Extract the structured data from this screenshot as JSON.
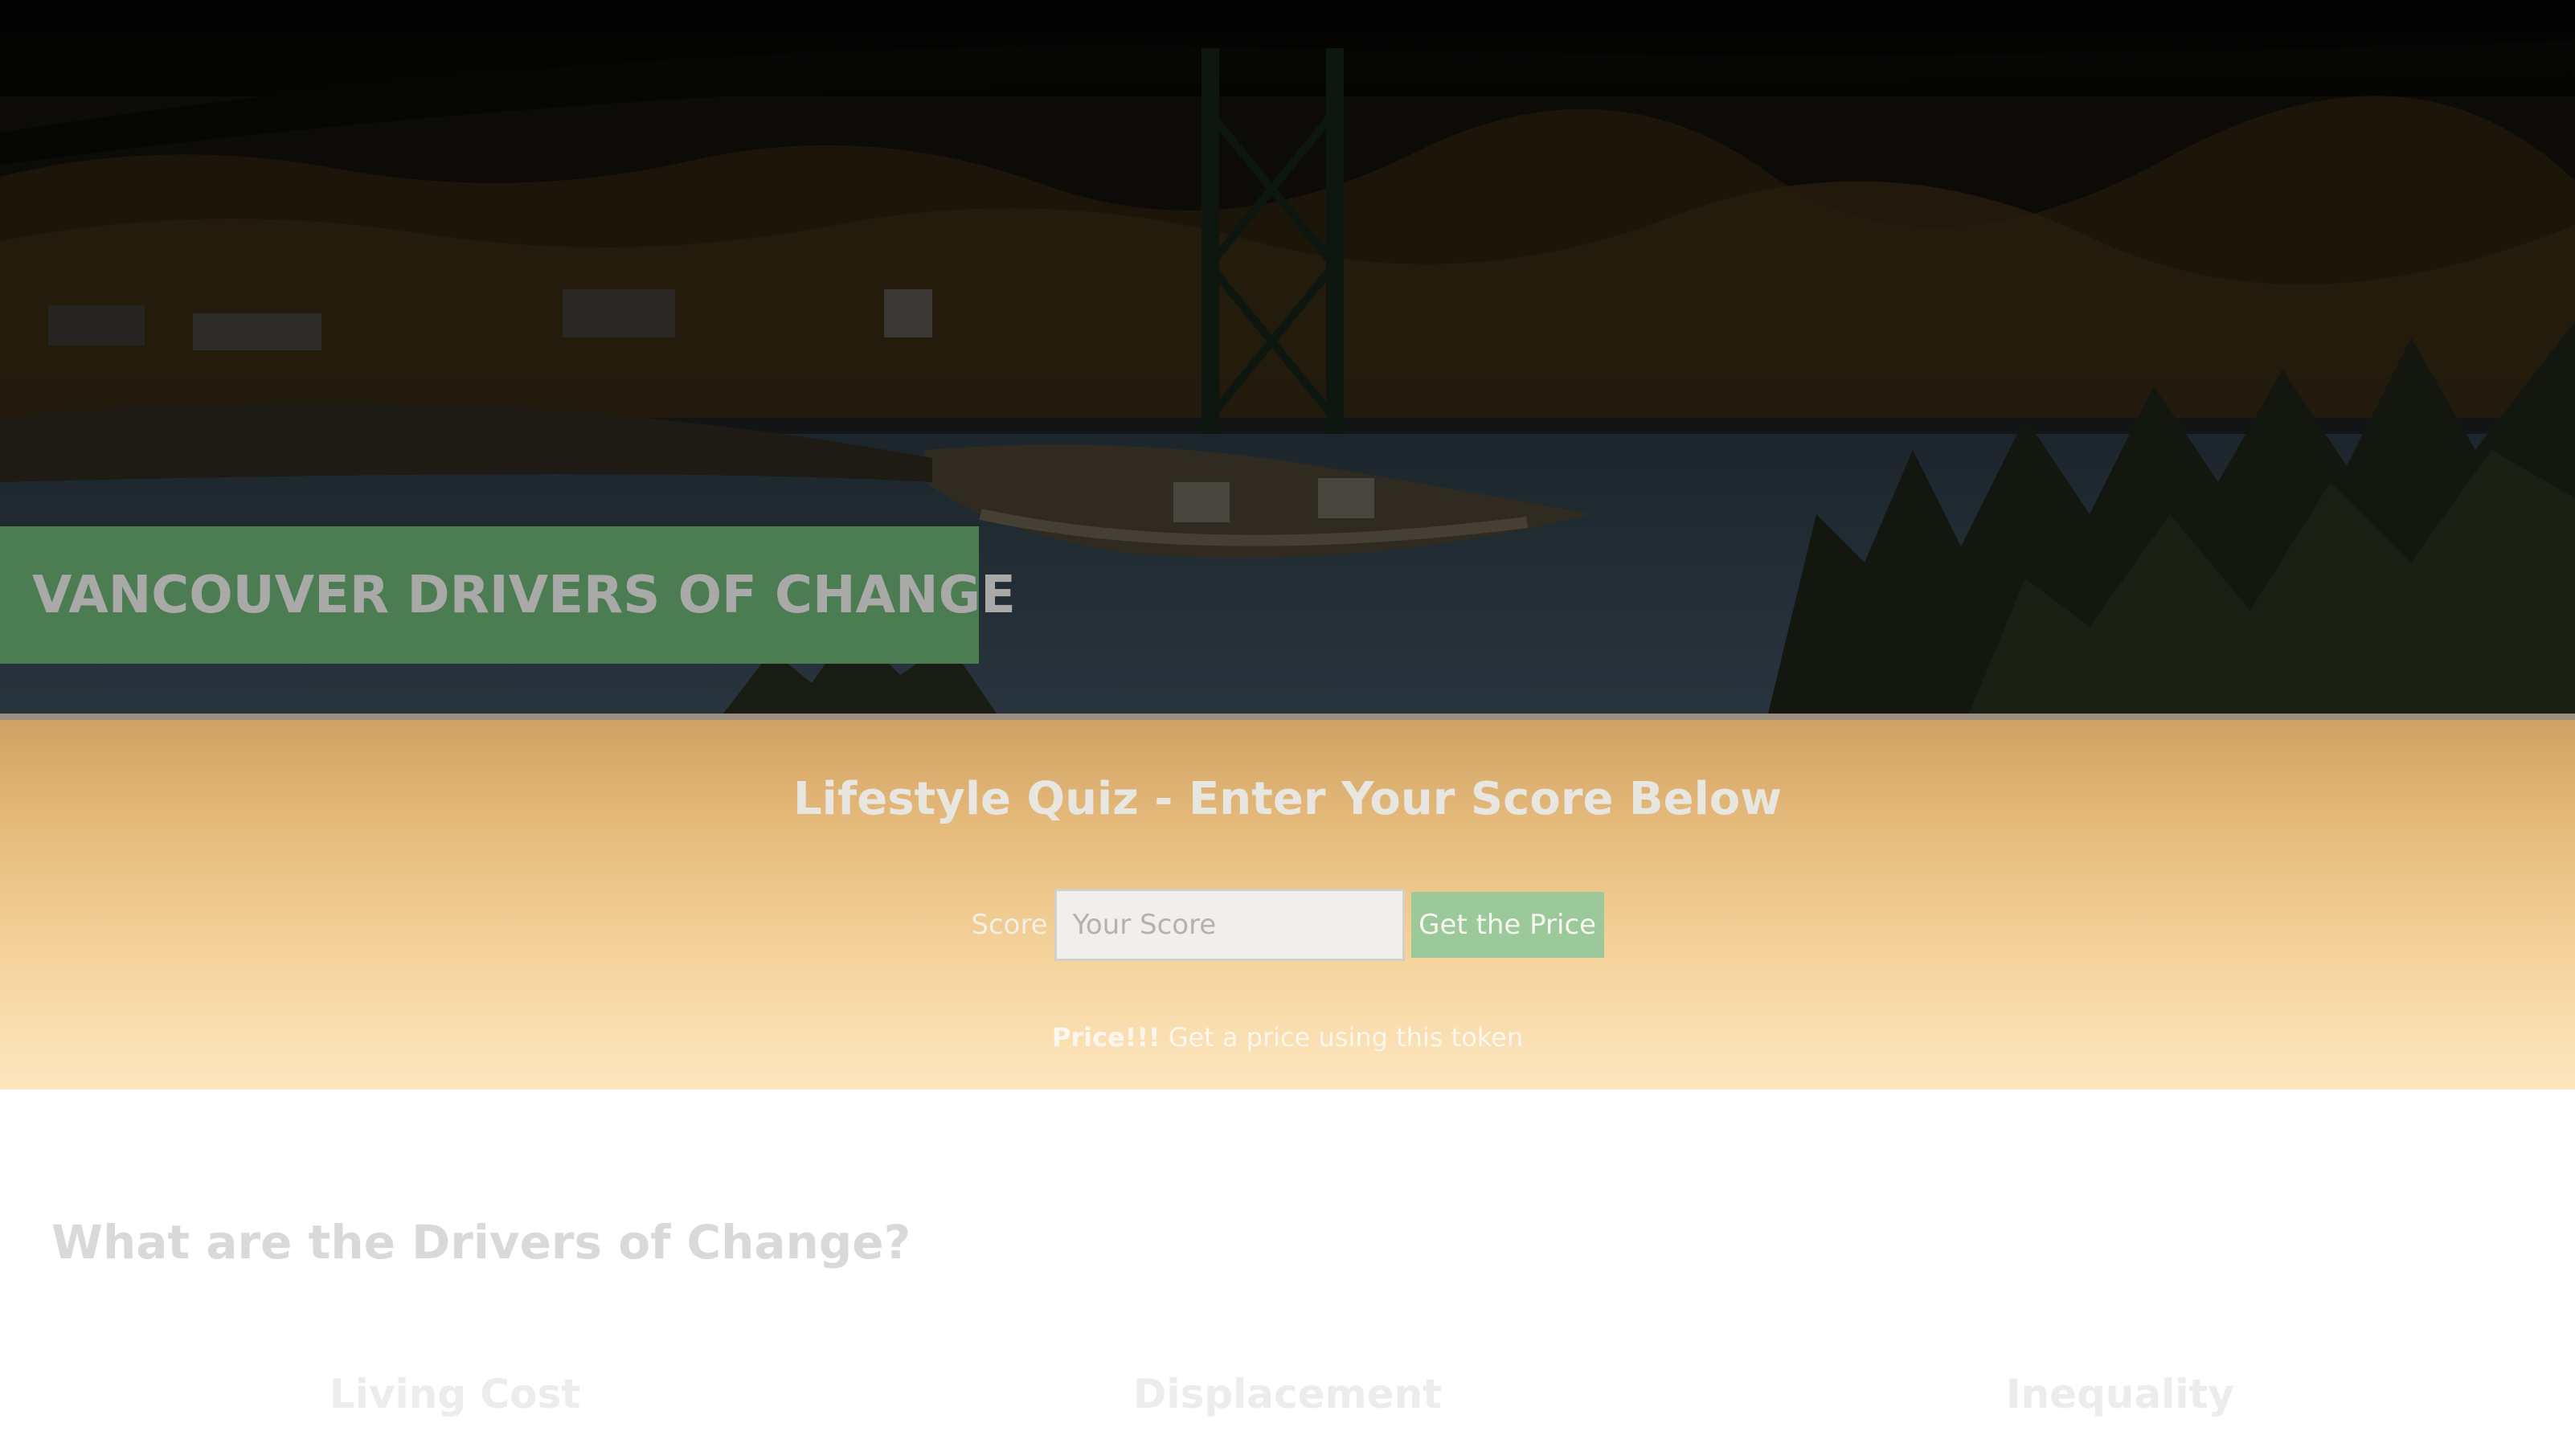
{
  "hero": {
    "title": "VANCOUVER DRIVERS OF CHANGE"
  },
  "quiz": {
    "title": "Lifestyle Quiz - Enter Your Score Below",
    "score_label": "Score",
    "score_placeholder": "Your Score",
    "score_value": "",
    "button_label": "Get the Price",
    "price_strong": "Price!!!",
    "price_text": " Get a price using this token"
  },
  "drivers": {
    "heading": "What are the Drivers of Change?",
    "columns": [
      {
        "label": "Living Cost"
      },
      {
        "label": "Displacement"
      },
      {
        "label": "Inequality"
      }
    ]
  },
  "colors": {
    "title_box": "#4c7c52",
    "button": "#9cc99a",
    "quiz_band_top": "#cfa264",
    "quiz_band_bottom": "#fde6bf"
  }
}
